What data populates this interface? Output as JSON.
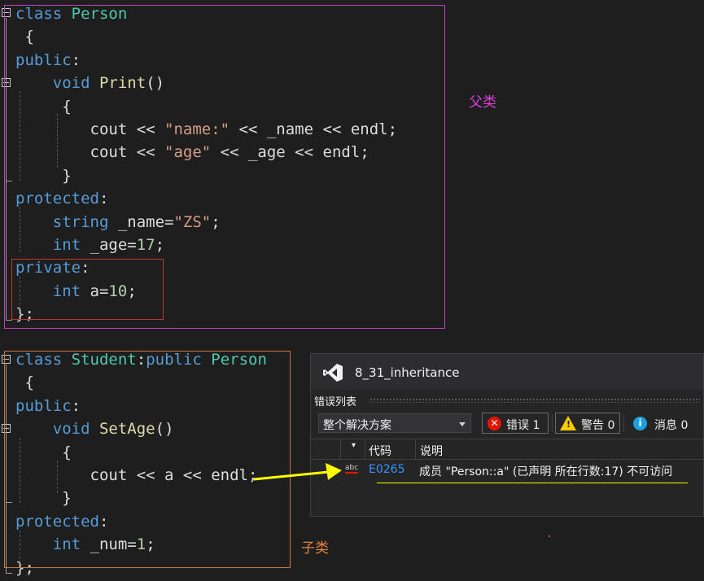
{
  "code_top": {
    "lines": [
      [
        [
          "kw",
          "class"
        ],
        [
          "pl",
          " "
        ],
        [
          "ty",
          "Person"
        ]
      ],
      [
        [
          "pl",
          " {"
        ]
      ],
      [
        [
          "kw",
          "public"
        ],
        [
          "pl",
          ":"
        ]
      ],
      [
        [
          "pl",
          "    "
        ],
        [
          "kw",
          "void"
        ],
        [
          "pl",
          " "
        ],
        [
          "fn",
          "Print"
        ],
        [
          "pl",
          "()"
        ]
      ],
      [
        [
          "pl",
          "     {"
        ]
      ],
      [
        [
          "pl",
          "        cout << "
        ],
        [
          "str",
          "\"name:\""
        ],
        [
          "pl",
          " << _name << endl;"
        ]
      ],
      [
        [
          "pl",
          "        cout << "
        ],
        [
          "str",
          "\"age\""
        ],
        [
          "pl",
          " << _age << endl;"
        ]
      ],
      [
        [
          "pl",
          "     }"
        ]
      ],
      [
        [
          "kw",
          "protected"
        ],
        [
          "pl",
          ":"
        ]
      ],
      [
        [
          "pl",
          "    "
        ],
        [
          "kw",
          "string"
        ],
        [
          "pl",
          " _name="
        ],
        [
          "str",
          "\"ZS\""
        ],
        [
          "pl",
          ";"
        ]
      ],
      [
        [
          "pl",
          "    "
        ],
        [
          "kw",
          "int"
        ],
        [
          "pl",
          " _age="
        ],
        [
          "num",
          "17"
        ],
        [
          "pl",
          ";"
        ]
      ],
      [
        [
          "kw",
          "private"
        ],
        [
          "pl",
          ":"
        ]
      ],
      [
        [
          "pl",
          "    "
        ],
        [
          "kw",
          "int"
        ],
        [
          "pl",
          " a="
        ],
        [
          "num",
          "10"
        ],
        [
          "pl",
          ";"
        ]
      ],
      [
        [
          "pl",
          "};"
        ]
      ]
    ]
  },
  "code_bottom": {
    "lines": [
      [
        [
          "kw",
          "class"
        ],
        [
          "pl",
          " "
        ],
        [
          "ty",
          "Student"
        ],
        [
          "pl",
          ":"
        ],
        [
          "kw",
          "public"
        ],
        [
          "pl",
          " "
        ],
        [
          "ty",
          "Person"
        ]
      ],
      [
        [
          "pl",
          " {"
        ]
      ],
      [
        [
          "kw",
          "public"
        ],
        [
          "pl",
          ":"
        ]
      ],
      [
        [
          "pl",
          "    "
        ],
        [
          "kw",
          "void"
        ],
        [
          "pl",
          " "
        ],
        [
          "fn",
          "SetAge"
        ],
        [
          "pl",
          "()"
        ]
      ],
      [
        [
          "pl",
          "     {"
        ]
      ],
      [
        [
          "pl",
          "        cout << a << endl;"
        ]
      ],
      [
        [
          "pl",
          "     }"
        ]
      ],
      [
        [
          "kw",
          "protected"
        ],
        [
          "pl",
          ":"
        ]
      ],
      [
        [
          "pl",
          "    "
        ],
        [
          "kw",
          "int"
        ],
        [
          "pl",
          " _num="
        ],
        [
          "num",
          "1"
        ],
        [
          "pl",
          ";"
        ]
      ],
      [
        [
          "pl",
          "};"
        ]
      ]
    ]
  },
  "notes": {
    "parent": "父类",
    "child": "子类"
  },
  "colors": {
    "parent_box": "#c040c0",
    "private_box": "#c0392b",
    "child_box": "#c8783c",
    "arrow": "#ffff00"
  },
  "error_list": {
    "window_title": "8_31_inheritance",
    "panel_label": "错误列表",
    "scope_select": "整个解决方案",
    "errors_label": "错误 1",
    "warnings_label": "警告 0",
    "messages_label": "消息 0",
    "col_code": "代码",
    "col_desc": "说明",
    "row": {
      "code": "E0265",
      "description": "成员 \"Person::a\" (已声明 所在行数:17) 不可访问"
    }
  }
}
